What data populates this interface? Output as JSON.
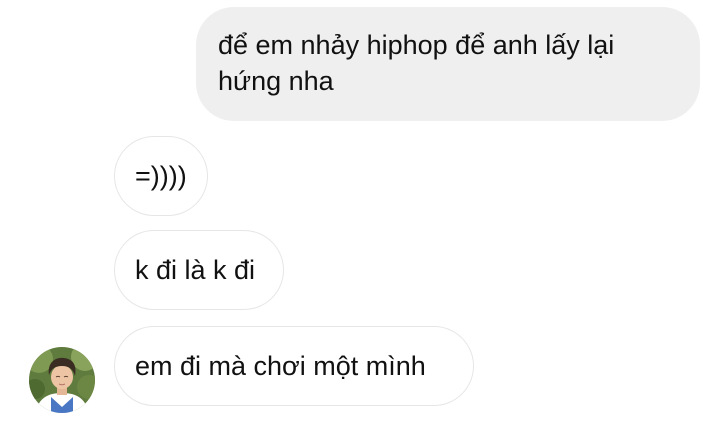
{
  "conversation": {
    "messages": [
      {
        "direction": "sent",
        "text": "để em nhảy hiphop để anh lấy lại hứng nha"
      },
      {
        "direction": "received",
        "text": "=))))"
      },
      {
        "direction": "received",
        "text": "k đi là k đi"
      },
      {
        "direction": "received",
        "text": "em đi mà chơi một mình"
      }
    ]
  },
  "colors": {
    "sent_bubble": "#efefef",
    "received_bubble_border": "#e6e6e6",
    "text": "#111111"
  }
}
